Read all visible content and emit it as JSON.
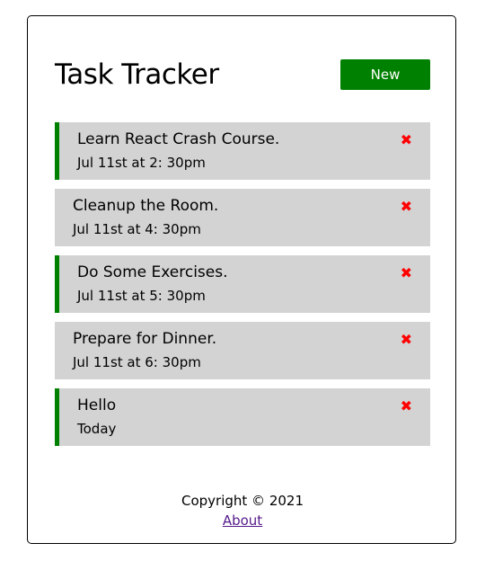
{
  "header": {
    "title": "Task Tracker",
    "add_button_label": "New"
  },
  "tasks": [
    {
      "text": "Learn React Crash Course.",
      "day": "Jul 11st at 2: 30pm",
      "reminder": true
    },
    {
      "text": "Cleanup the Room.",
      "day": "Jul 11st at 4: 30pm",
      "reminder": false
    },
    {
      "text": "Do Some Exercises.",
      "day": "Jul 11st at 5: 30pm",
      "reminder": true
    },
    {
      "text": "Prepare for Dinner.",
      "day": "Jul 11st at 6: 30pm",
      "reminder": false
    },
    {
      "text": "Hello",
      "day": "Today",
      "reminder": true
    }
  ],
  "delete_glyph": "✖",
  "footer": {
    "copyright": "Copyright © 2021",
    "about_link": "About"
  },
  "colors": {
    "accent": "#008000",
    "task_bg": "#d3d3d3",
    "delete": "#ff0000",
    "link": "#551a8b"
  }
}
